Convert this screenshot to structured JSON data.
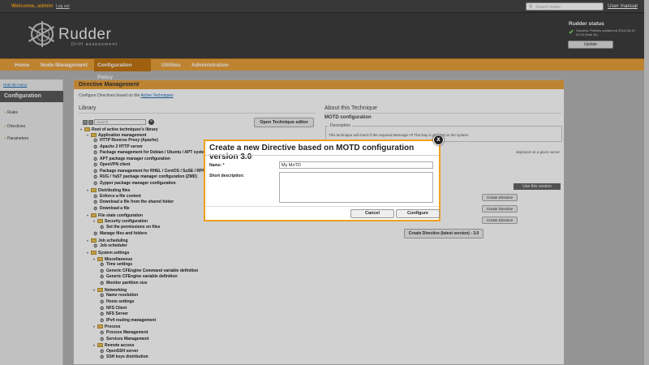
{
  "topbar": {
    "welcome": "Welcome, admin",
    "logout": "Log out",
    "search_placeholder": "Search nodes",
    "user_manual": "User manual"
  },
  "header": {
    "logo": "Rudder",
    "logo_sub": "Drift assessment",
    "status_title": "Rudder status",
    "status_text": "Success: Policies updated at 2014-08-14 01:32 (took 3s)",
    "update_button": "Update"
  },
  "nav": {
    "items": [
      "Home",
      "Node Management",
      "Configuration Policy",
      "Utilities",
      "Administration"
    ],
    "active": "Configuration Policy"
  },
  "sidebar": {
    "hide_menu": "Hide the menu",
    "title": "Configuration",
    "items": [
      "Rules",
      "Directives",
      "Parameters"
    ]
  },
  "main": {
    "title": "Directive Management",
    "subtitle_prefix": "Configure Directives based on the",
    "subtitle_link": "Active Techniques",
    "library_title": "Library",
    "search_placeholder": "Search",
    "open_editor": "Open Technique editor",
    "tree": [
      "Root of active techniques's library",
      "Application management",
      "HTTP Reverse Proxy (Apache)",
      "Apache 2 HTTP server",
      "Package management for Debian / Ubuntu / APT systems",
      "APT package manager configuration",
      "OpenVPN client",
      "Package management for RHEL / CentOS / SuSE / RPM systems",
      "RUG / YaST package manager configuration (ZMD)",
      "Zypper package manager configuration",
      "Distributing files",
      "Enforce a file content",
      "Download a file from the shared folder",
      "Download a file",
      "File state configuration",
      "Security configuration",
      "Set the permissions on files",
      "Manage files and folders",
      "Job scheduling",
      "Job scheduler",
      "System settings",
      "Miscellaneous",
      "Time settings",
      "Generic CFEngine Command variable definition",
      "Generic CFEngine variable definition",
      "Monitor partition size",
      "Networking",
      "Name resolution",
      "Hosts settings",
      "NFS Client",
      "NFS Server",
      "IPv4 routing management",
      "Process",
      "Process Management",
      "Services Management",
      "Remote access",
      "OpenSSH server",
      "SSH keys distribution"
    ]
  },
  "about": {
    "title": "About this Technique",
    "name": "MOTD configuration",
    "desc_legend": "Description",
    "desc_text": "This technique will check if the required Message Of The Day is present on the system.",
    "deploy_text": "deployed on a given server",
    "use_version": "Use this version",
    "create_directive": "Create Directive",
    "create_latest": "Create Directive (latest version) - 3.0"
  },
  "modal": {
    "title": "Create a new Directive based on MOTD configuration version 3.0",
    "close": "x",
    "name_label": "Name: *",
    "name_value": "My MoTD",
    "desc_label": "Short description:",
    "desc_value": "",
    "cancel": "Cancel",
    "configure": "Configure"
  }
}
